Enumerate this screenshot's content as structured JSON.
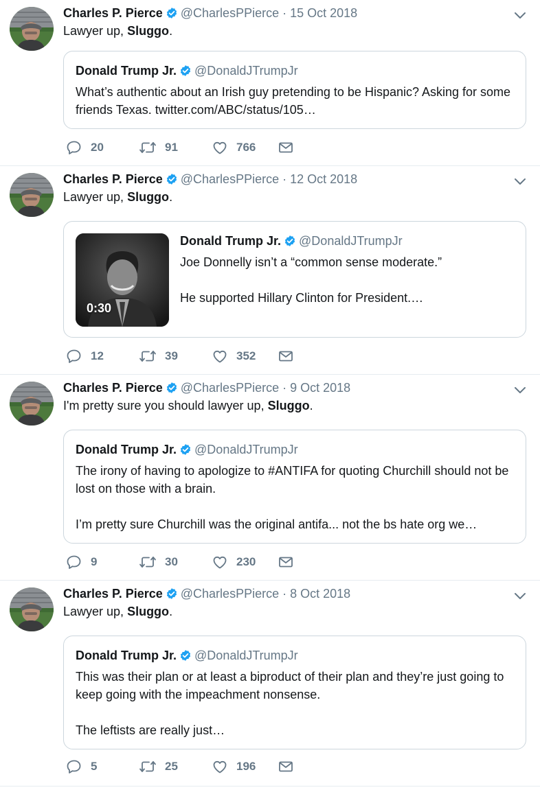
{
  "colors": {
    "verified": "#1da1f2",
    "text": "#14171a",
    "muted": "#657786",
    "border": "#ccd6dd"
  },
  "tweets": [
    {
      "author": {
        "name": "Charles P. Pierce",
        "handle": "@CharlesPPierce"
      },
      "separator": "·",
      "date": "15 Oct 2018",
      "text_prefix": "Lawyer up, ",
      "text_bold": "Sluggo",
      "text_suffix": ".",
      "quoted": {
        "name": "Donald Trump Jr.",
        "handle": "@DonaldJTrumpJr",
        "lines": [
          "What’s authentic about an Irish guy pretending to be Hispanic? Asking for some friends Texas. twitter.com/ABC/status/105…"
        ]
      },
      "counts": {
        "replies": "20",
        "retweets": "91",
        "likes": "766"
      }
    },
    {
      "author": {
        "name": "Charles P. Pierce",
        "handle": "@CharlesPPierce"
      },
      "separator": "·",
      "date": "12 Oct 2018",
      "text_prefix": "Lawyer up, ",
      "text_bold": "Sluggo",
      "text_suffix": ".",
      "quoted": {
        "name": "Donald Trump Jr.",
        "handle": "@DonaldJTrumpJr",
        "lines": [
          "Joe Donnelly isn’t a “common sense moderate.”",
          "",
          "He supported Hillary Clinton for President.…"
        ],
        "media": {
          "type": "video",
          "duration": "0:30"
        }
      },
      "counts": {
        "replies": "12",
        "retweets": "39",
        "likes": "352"
      }
    },
    {
      "author": {
        "name": "Charles P. Pierce",
        "handle": "@CharlesPPierce"
      },
      "separator": "·",
      "date": "9 Oct 2018",
      "text_prefix": "I'm pretty sure you should lawyer up, ",
      "text_bold": "Sluggo",
      "text_suffix": ".",
      "quoted": {
        "name": "Donald Trump Jr.",
        "handle": "@DonaldJTrumpJr",
        "lines": [
          "The irony of having to apologize to #ANTIFA for quoting Churchill should not be lost on those with a brain.",
          "",
          "I’m pretty sure Churchill was the original antifa... not the bs hate org we…"
        ]
      },
      "counts": {
        "replies": "9",
        "retweets": "30",
        "likes": "230"
      }
    },
    {
      "author": {
        "name": "Charles P. Pierce",
        "handle": "@CharlesPPierce"
      },
      "separator": "·",
      "date": "8 Oct 2018",
      "text_prefix": "Lawyer up, ",
      "text_bold": "Sluggo",
      "text_suffix": ".",
      "quoted": {
        "name": "Donald Trump Jr.",
        "handle": "@DonaldJTrumpJr",
        "lines": [
          "This was their plan or at least a biproduct of their plan and they’re just going to keep going with the impeachment nonsense.",
          "",
          "The leftists are really just…"
        ]
      },
      "counts": {
        "replies": "5",
        "retweets": "25",
        "likes": "196"
      }
    }
  ],
  "icons": {
    "verified": "verified-badge-icon",
    "caret": "chevron-down-icon",
    "reply": "reply-icon",
    "retweet": "retweet-icon",
    "like": "heart-icon",
    "dm": "envelope-icon"
  }
}
